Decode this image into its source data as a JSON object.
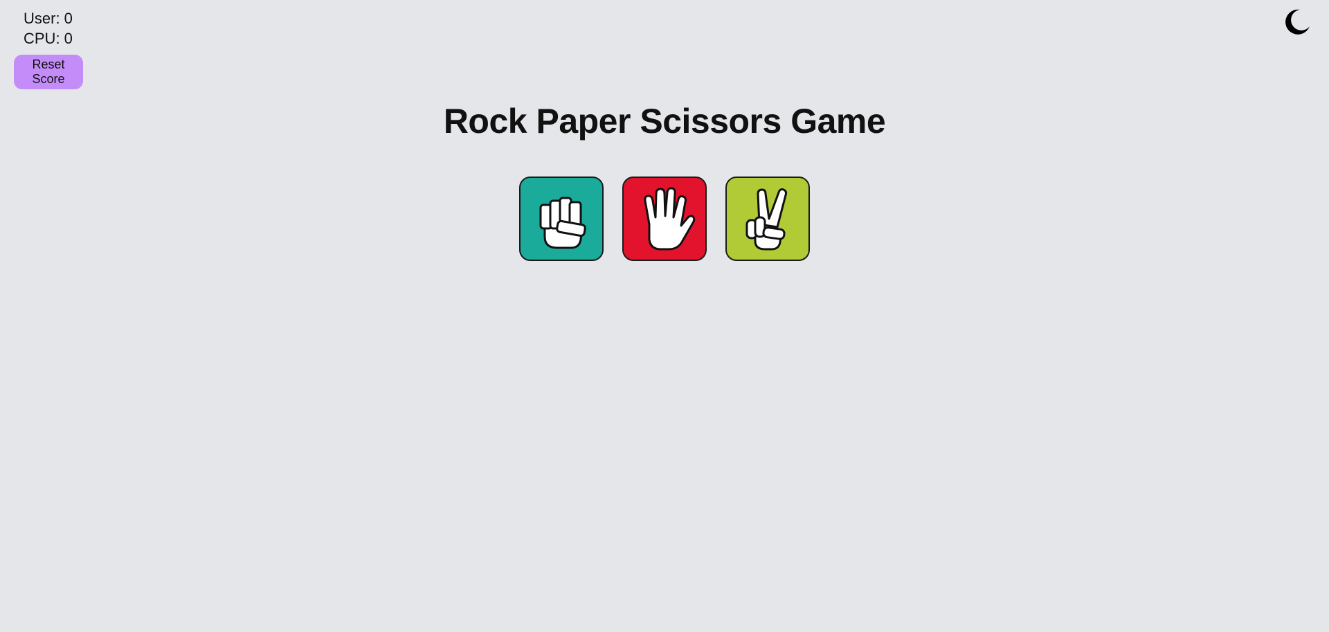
{
  "score": {
    "user_label": "User: 0",
    "cpu_label": "CPU: 0"
  },
  "reset_button_label": "Reset Score",
  "theme_toggle_icon": "moon-icon",
  "title": "Rock Paper Scissors Game",
  "choices": [
    {
      "name": "rock",
      "icon": "rock-fist-icon",
      "color": "#1aab9b"
    },
    {
      "name": "paper",
      "icon": "paper-hand-icon",
      "color": "#e3132e"
    },
    {
      "name": "scissors",
      "icon": "scissors-peace-icon",
      "color": "#b1cb36"
    }
  ],
  "colors": {
    "background": "#e5e6ea",
    "reset_button": "#c38cf8",
    "text": "#111111"
  }
}
